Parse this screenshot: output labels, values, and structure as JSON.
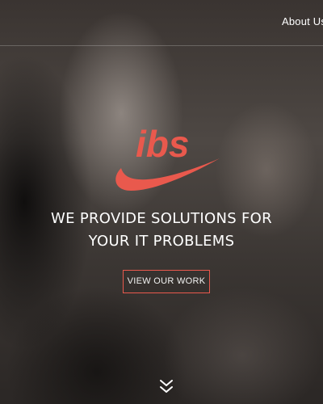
{
  "header": {
    "nav_items": [
      {
        "label": "About Us"
      }
    ]
  },
  "hero": {
    "logo_text": "ibs",
    "headline_line1": "WE PROVIDE SOLUTIONS FOR",
    "headline_line2": "YOUR IT PROBLEMS",
    "cta_label": "VIEW OUR WORK",
    "scroll_icon": "double-chevron-down-icon"
  },
  "colors": {
    "brand_accent": "#e9594d",
    "text": "#ffffff"
  }
}
